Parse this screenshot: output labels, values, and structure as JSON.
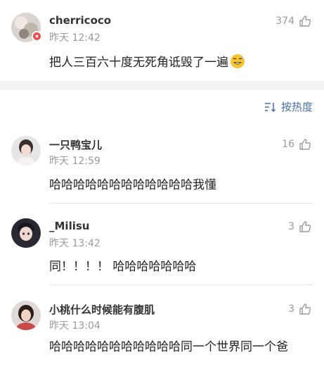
{
  "top_comment": {
    "username": "cherricoco",
    "time": "昨天 12:42",
    "likes": "374",
    "text": "把人三百六十度无死角诋毁了一遍",
    "emoji": "grinning-sweat-emoji",
    "badge_color": "#f04b4b"
  },
  "sort": {
    "label": "按热度",
    "icon": "sort-icon"
  },
  "replies": [
    {
      "username": "一只鸭宝儿",
      "time": "昨天 12:59",
      "likes": "16",
      "text": "哈哈哈哈哈哈哈哈哈哈哈哈我懂"
    },
    {
      "username": "_Milisu",
      "time": "昨天 13:42",
      "likes": "3",
      "text": "同！！！！ 哈哈哈哈哈哈哈"
    },
    {
      "username": "小桃什么时候能有腹肌",
      "time": "昨天 13:04",
      "likes": "3",
      "text": "哈哈哈哈哈哈哈哈哈哈哈同一个世界同一个爸"
    }
  ],
  "colors": {
    "accent": "#4a6fa5",
    "muted": "#9b9b9b",
    "separator": "#f2f2f2"
  }
}
